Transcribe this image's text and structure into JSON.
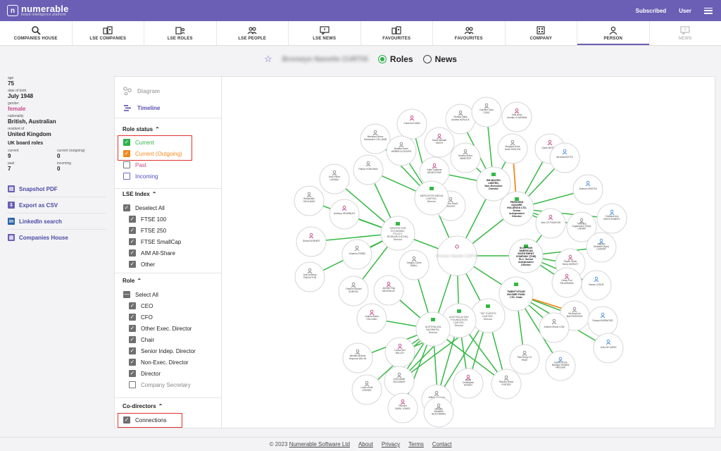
{
  "app": {
    "logo_text": "numerable",
    "logo_tagline": "board intelligence platform",
    "subscribed": "Subscribed",
    "user": "User"
  },
  "nav": [
    {
      "label": "COMPANIES HOUSE",
      "icon": "search-icon"
    },
    {
      "label": "LSE COMPANIES",
      "icon": "buildings-icon"
    },
    {
      "label": "LSE ROLES",
      "icon": "building-person-icon"
    },
    {
      "label": "LSE PEOPLE",
      "icon": "people-icon"
    },
    {
      "label": "LSE NEWS",
      "icon": "chat-icon"
    },
    {
      "label": "FAVOURITES",
      "icon": "buildings-icon"
    },
    {
      "label": "FAVOURITES",
      "icon": "people-icon"
    },
    {
      "label": "COMPANY",
      "icon": "building-icon"
    },
    {
      "label": "PERSON",
      "icon": "person-icon",
      "active": true
    },
    {
      "label": "NEWS",
      "icon": "chat-icon",
      "disabled": true
    }
  ],
  "header": {
    "person_name": "Bronwyn Nanette CURTIS",
    "roles_label": "Roles",
    "news_label": "News"
  },
  "profile": {
    "age_label": "age",
    "age": "75",
    "dob_label": "date of birth",
    "dob": "July 1948",
    "gender_label": "gender",
    "gender": "female",
    "nationality_label": "nationality",
    "nationality": "British, Australian",
    "resident_label": "resident of",
    "resident": "United Kingdom",
    "uk_roles_title": "UK board roles",
    "current_label": "current",
    "current": "9",
    "current_outgoing_label": "current (outgoing)",
    "current_outgoing": "0",
    "past_label": "past",
    "past": "7",
    "incoming_label": "incoming",
    "incoming": "0"
  },
  "links": [
    {
      "label": "Snapshot PDF",
      "icon": "pdf-icon"
    },
    {
      "label": "Export as CSV",
      "icon": "csv-icon"
    },
    {
      "label": "LinkedIn search",
      "icon": "linkedin-icon"
    },
    {
      "label": "Companies House",
      "icon": "building-icon"
    }
  ],
  "view": {
    "diagram": "Diagram",
    "timeline": "Timeline"
  },
  "filters": {
    "role_status_title": "Role status",
    "role_status": [
      {
        "label": "Current",
        "state": "green"
      },
      {
        "label": "Current (Outgoing)",
        "state": "orange"
      },
      {
        "label": "Past",
        "state": "empty"
      },
      {
        "label": "Incoming",
        "state": "blue"
      }
    ],
    "lse_title": "LSE Index",
    "lse_all": "Deselect All",
    "lse": [
      "FTSE 100",
      "FTSE 250",
      "FTSE SmallCap",
      "AIM All-Share",
      "Other"
    ],
    "role_title": "Role",
    "role_all": "Select All",
    "roles": [
      "CEO",
      "CFO",
      "Other Exec. Director",
      "Chair",
      "Senior Indep. Director",
      "Non-Exec. Director",
      "Director",
      "Company Secretary"
    ],
    "codirectors_title": "Co-directors",
    "connections": "Connections"
  },
  "graph": {
    "companies": [
      {
        "label": "MERCATOR MEDIA LIMITED, Director"
      },
      {
        "label": "CENTRE FOR ECONOMIC POLICY RESEARCH(THE), Director"
      },
      {
        "label": "BH MACRO LIMITED, Non-Executive Director"
      },
      {
        "label": "PERSHING SQUARE HOLDINGS LTD, Senior Independent Director"
      },
      {
        "label": "SCOTTISH AMERICAN INVESTMENT COMPANY (THE) PLC, Senior Independent Director"
      },
      {
        "label": "TWENTYFOUR INCOME FUND LTD, Chair"
      },
      {
        "label": "'TAF' EVENTS LIMITED, Director"
      },
      {
        "label": "AUSTRALIA DAY FOUNDATION LIMITED, Director"
      },
      {
        "label": "AUSTRALIAN BUSINESS, Director"
      }
    ],
    "people": [
      {
        "label": "Cameron DUNN"
      },
      {
        "label": "Marianna Bruno Ramsuden COLLUMB"
      },
      {
        "label": "Beatrice Anne WEBER-DI SOURO"
      },
      {
        "label": "David Michael SMITH"
      },
      {
        "label": "Richard Miles Andrew HURLICK"
      },
      {
        "label": "Caroline Jean COKE"
      },
      {
        "label": "Julia Anne Jennifer CHAPMAN"
      },
      {
        "label": "Jean-Pierre LANDAU"
      },
      {
        "label": "Patrick HONOHAN"
      },
      {
        "label": "Katie Susanne HEIGESTRUP"
      },
      {
        "label": "Andrew Arthur WEBSTER"
      },
      {
        "label": "Margaret Anna Annie FARLOW"
      },
      {
        "label": "Claire WHITTET"
      },
      {
        "label": "Nicholas BOTTA"
      },
      {
        "label": "Reshmalini GUGLIANO"
      },
      {
        "label": "Anthony GRABBLES"
      },
      {
        "label": "Andrew David HOCKEY"
      },
      {
        "label": "Andrew HENTON"
      },
      {
        "label": "John LE POIDEVIN"
      },
      {
        "label": "Tomhaya Dugananmu (Tass) LINNAK"
      },
      {
        "label": "Christina Ann MONTGOMERY"
      },
      {
        "label": "Dirrani SORNER"
      },
      {
        "label": "Kathryn Elizabeth (Kym) LUMONT"
      },
      {
        "label": "Johanna STABB"
      },
      {
        "label": "Rupert Oliver Henry MORLEY"
      },
      {
        "label": "Gregory Carrie SMALL"
      },
      {
        "label": "John Anthony PINGLETON"
      },
      {
        "label": "Fassy Puri PALANDANA"
      },
      {
        "label": "Marcio LESLIE"
      },
      {
        "label": "Charles Richard St BEVIN"
      },
      {
        "label": "Jennifer Ray MACKINLAY"
      },
      {
        "label": "Nicholas Ian MACPHERSON"
      },
      {
        "label": "Rompot BURWOOD"
      },
      {
        "label": "Joanna Maria HOLLAND"
      },
      {
        "label": "Andrew Simon LOW"
      },
      {
        "label": "John DE GARIS"
      },
      {
        "label": "Louise Ann BULLEY"
      },
      {
        "label": "Michael Andrew Seymour WILLIN"
      },
      {
        "label": "Paul Henry LE PAGE"
      },
      {
        "label": "Joanne Linda Monique Roberta FRESSIN"
      },
      {
        "label": "John Martin MCGUINNY"
      },
      {
        "label": "Jeffrey Sheridan YOUNG"
      },
      {
        "label": "David Christopher HIGNEY"
      },
      {
        "label": "Richard Bruce PORTER"
      },
      {
        "label": "Lorien Keith CROSBY"
      },
      {
        "label": "Richard BARIL-JONES"
      },
      {
        "label": "Georgia Elizabeth BLACKBURN"
      }
    ]
  },
  "footer": {
    "copyright": "© 2023",
    "company": "Numerable Software Ltd",
    "about": "About",
    "privacy": "Privacy",
    "terms": "Terms",
    "contact": "Contact"
  }
}
